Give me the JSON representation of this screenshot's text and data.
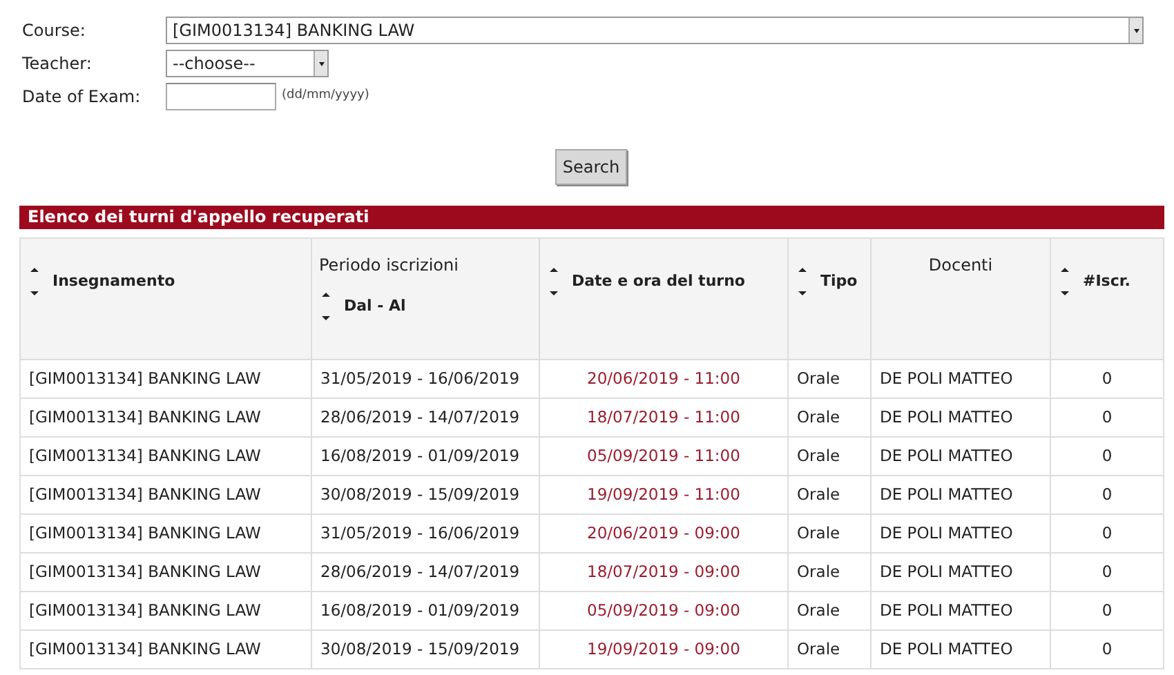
{
  "form": {
    "fields": [
      {
        "kind": "wide_select",
        "label": "Course:",
        "value": "[GIM0013134] BANKING LAW"
      },
      {
        "kind": "select",
        "label": "Teacher:",
        "value": "--choose--"
      },
      {
        "kind": "text",
        "label": "Date of Exam:",
        "hint": "(dd/mm/yyyy)"
      }
    ],
    "button": "Search"
  },
  "results": {
    "title": "Elenco dei turni d'appello recuperati",
    "columns": [
      {
        "label": "Insegnamento",
        "sortable": true
      },
      {
        "group": "Periodo iscrizioni",
        "label": "Dal - Al",
        "sortable": true
      },
      {
        "label": "Date e ora del turno",
        "sortable": true
      },
      {
        "label": "Tipo",
        "sortable": true
      },
      {
        "label": "Docenti",
        "sortable": false
      },
      {
        "label": "#Iscr.",
        "sortable": true
      }
    ],
    "rows": [
      [
        "[GIM0013134] BANKING LAW",
        "31/05/2019 - 16/06/2019",
        "20/06/2019 - 11:00",
        "Orale",
        "DE POLI MATTEO",
        "0"
      ],
      [
        "[GIM0013134] BANKING LAW",
        "28/06/2019 - 14/07/2019",
        "18/07/2019 - 11:00",
        "Orale",
        "DE POLI MATTEO",
        "0"
      ],
      [
        "[GIM0013134] BANKING LAW",
        "16/08/2019 - 01/09/2019",
        "05/09/2019 - 11:00",
        "Orale",
        "DE POLI MATTEO",
        "0"
      ],
      [
        "[GIM0013134] BANKING LAW",
        "30/08/2019 - 15/09/2019",
        "19/09/2019 - 11:00",
        "Orale",
        "DE POLI MATTEO",
        "0"
      ],
      [
        "[GIM0013134] BANKING LAW",
        "31/05/2019 - 16/06/2019",
        "20/06/2019 - 09:00",
        "Orale",
        "DE POLI MATTEO",
        "0"
      ],
      [
        "[GIM0013134] BANKING LAW",
        "28/06/2019 - 14/07/2019",
        "18/07/2019 - 09:00",
        "Orale",
        "DE POLI MATTEO",
        "0"
      ],
      [
        "[GIM0013134] BANKING LAW",
        "16/08/2019 - 01/09/2019",
        "05/09/2019 - 09:00",
        "Orale",
        "DE POLI MATTEO",
        "0"
      ],
      [
        "[GIM0013134] BANKING LAW",
        "30/08/2019 - 15/09/2019",
        "19/09/2019 - 09:00",
        "Orale",
        "DE POLI MATTEO",
        "0"
      ]
    ]
  }
}
